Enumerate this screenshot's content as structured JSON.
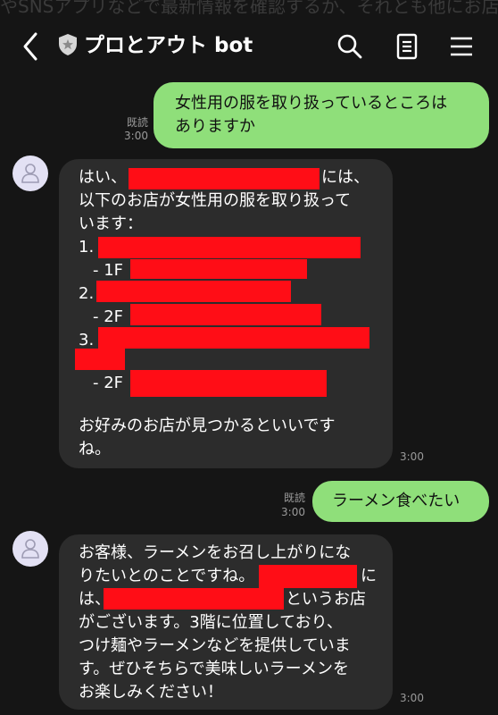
{
  "background_text": "やSNSアプリなどで最新情報を確認するか、それとも他にお店がありますか？",
  "header": {
    "title": "プロとアウト bot",
    "back_icon": "chevron-left-icon",
    "shield_icon": "shield-icon",
    "search_icon": "search-icon",
    "notes_icon": "notes-icon",
    "menu_icon": "menu-icon"
  },
  "messages": {
    "m1": {
      "lines": [
        "女性用の服を取り扱っているところは",
        "ありますか"
      ],
      "read": "既読",
      "time": "3:00"
    },
    "m2": {
      "lines": [
        "はい、",
        "には、",
        "以下のお店が女性用の服を取り扱って",
        "います：",
        "1. あ",
        "- 1F",
        "2.",
        "- 2F",
        "3.",
        "- 2F",
        "お好みのお店が見つかるといいです",
        "ね。"
      ],
      "time": "3:00"
    },
    "m3": {
      "text": "ラーメン食べたい",
      "read": "既読",
      "time": "3:00"
    },
    "m4": {
      "lines": [
        "お客様、ラーメンをお召し上がりにな",
        "りたいとのことですね。",
        "に",
        "は、",
        "というお店",
        "がございます。3階に位置しており、",
        "つけ麺やラーメンなどを提供していま",
        "す。ぜひそちらで美味しいラーメンを",
        "お楽しみください！"
      ],
      "time": "3:00"
    }
  },
  "colors": {
    "background": "#151515",
    "user_bubble": "#8fdf7a",
    "bot_bubble": "#2c2c2c",
    "redaction": "#ff0d16"
  }
}
